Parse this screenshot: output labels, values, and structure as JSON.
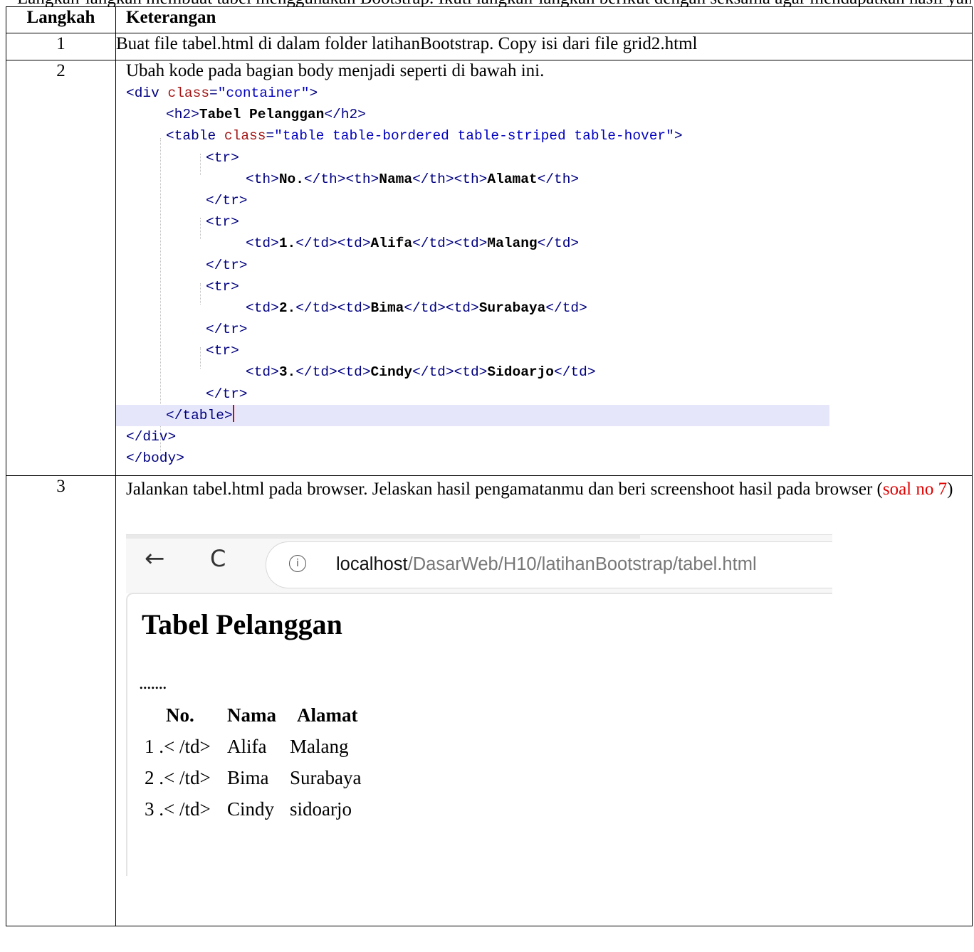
{
  "top_line": "Langkah-langkah membuat tabel menggunakan Bootstrap. Ikuti langkah-langkah berikut dengan seksama agar mendapatkan hasil yang diharapkan.",
  "headers": {
    "step": "Langkah",
    "desc": "Keterangan"
  },
  "rows": [
    {
      "num": "1",
      "text": "Buat file tabel.html di dalam folder latihanBootstrap. Copy isi dari file grid2.html"
    },
    {
      "num": "2",
      "text": "Ubah kode pada bagian body menjadi seperti di bawah ini."
    },
    {
      "num": "3",
      "text_before": "Jalankan tabel.html pada browser. Jelaskan hasil pengamatanmu dan beri screenshoot hasil pada browser (",
      "text_link": "soal no 7",
      "text_after": ")"
    }
  ],
  "code": {
    "div_open_tag": "<div ",
    "div_open_attr": "class",
    "div_open_eq": "=",
    "div_open_val": "\"container\"",
    "div_open_end": ">",
    "h2_open": "<h2>",
    "h2_text": "Tabel Pelanggan",
    "h2_close": "</h2>",
    "table_open_tag": "<table ",
    "table_open_attr": "class",
    "table_open_eq": "=",
    "table_open_val": "\"table table-bordered table-striped table-hover\"",
    "table_open_end": ">",
    "tr_open": "<tr>",
    "tr_close": "</tr>",
    "th_open": "<th>",
    "th_close": "</th>",
    "td_open": "<td>",
    "td_close": "</td>",
    "th_cells": [
      "No.",
      "Nama",
      "Alamat"
    ],
    "data_rows": [
      [
        "1.",
        "Alifa",
        "Malang"
      ],
      [
        "2.",
        "Bima",
        "Surabaya"
      ],
      [
        "3.",
        "Cindy",
        "Sidoarjo"
      ]
    ],
    "table_close": "</table>",
    "table_close_end": ">",
    "div_close": "</div>",
    "body_close": "</body>"
  },
  "browser": {
    "back_glyph": "←",
    "reload_glyph": "C",
    "info_glyph": "i",
    "url_host": "localhost",
    "url_path": "/DasarWeb/H10/latihanBootstrap/tabel.html",
    "heading": "Tabel Pelanggan",
    "dots": ".......",
    "result_header": [
      "No.",
      "Nama",
      "Alamat"
    ],
    "result_rows": [
      [
        "1 .< /td>",
        "Alifa",
        "Malang"
      ],
      [
        "2 .< /td>",
        "Bima",
        "Surabaya"
      ],
      [
        "3 .< /td>",
        "Cindy",
        "sidoarjo"
      ]
    ]
  }
}
